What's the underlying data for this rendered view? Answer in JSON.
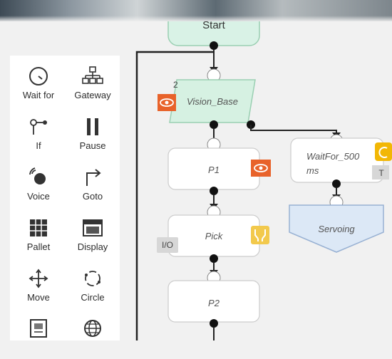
{
  "palette": {
    "tools": [
      {
        "label": "Wait for",
        "icon": "clock-icon"
      },
      {
        "label": "Gateway",
        "icon": "gateway-icon"
      },
      {
        "label": "If",
        "icon": "if-branch-icon"
      },
      {
        "label": "Pause",
        "icon": "pause-icon"
      },
      {
        "label": "Voice",
        "icon": "voice-icon"
      },
      {
        "label": "Goto",
        "icon": "goto-arrow-icon"
      },
      {
        "label": "Pallet",
        "icon": "pallet-grid-icon"
      },
      {
        "label": "Display",
        "icon": "display-window-icon"
      },
      {
        "label": "Move",
        "icon": "move-arrows-icon"
      },
      {
        "label": "Circle",
        "icon": "circle-arc-icon"
      },
      {
        "label": "",
        "icon": "frame-icon"
      },
      {
        "label": "",
        "icon": "globe-icon"
      }
    ]
  },
  "flow": {
    "start": "Start",
    "vision_base": "Vision_Base",
    "vision_base_index": "2",
    "p1": "P1",
    "pick": "Pick",
    "pick_badge": "I/O",
    "p2": "P2",
    "waitfor_line1": "WaitFor_500",
    "waitfor_line2": "ms",
    "waitfor_badge": "T",
    "servoing": "Servoing"
  },
  "colors": {
    "start_fill": "#d9f2e6",
    "vision_fill": "#d6f1e2",
    "servoing_fill": "#dce8f6",
    "eye_badge": "#e8622a",
    "pick_badge_fill": "#f2c94c",
    "wait_badge_fill": "#f2b705"
  }
}
